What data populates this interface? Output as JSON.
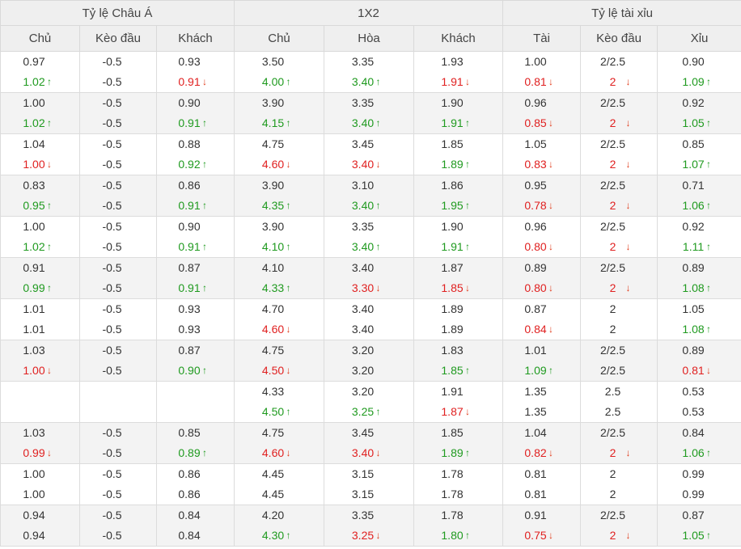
{
  "header": {
    "groups": [
      "Tỷ lệ Châu Á",
      "1X2",
      "Tỷ lệ tài xỉu"
    ],
    "columns": [
      "Chủ",
      "Kèo đầu",
      "Khách",
      "Chủ",
      "Hòa",
      "Khách",
      "Tài",
      "Kèo đầu",
      "Xỉu"
    ]
  },
  "icons": {
    "up": "arrow-up-icon",
    "down": "arrow-down-icon"
  },
  "colors": {
    "up": "#1f9a1f",
    "down": "#e02020",
    "header_bg": "#efefef",
    "alt_row_bg": "#f3f3f3"
  },
  "rows": [
    [
      [
        "0.97",
        "1.02",
        "u"
      ],
      [
        "-0.5",
        "-0.5",
        ""
      ],
      [
        "0.93",
        "0.91",
        "d"
      ],
      [
        "3.50",
        "4.00",
        "u"
      ],
      [
        "3.35",
        "3.40",
        "u"
      ],
      [
        "1.93",
        "1.91",
        "d"
      ],
      [
        "1.00",
        "0.81",
        "d"
      ],
      [
        "2/2.5",
        "2",
        "d"
      ],
      [
        "0.90",
        "1.09",
        "u"
      ]
    ],
    [
      [
        "1.00",
        "1.02",
        "u"
      ],
      [
        "-0.5",
        "-0.5",
        ""
      ],
      [
        "0.90",
        "0.91",
        "u"
      ],
      [
        "3.90",
        "4.15",
        "u"
      ],
      [
        "3.35",
        "3.40",
        "u"
      ],
      [
        "1.90",
        "1.91",
        "u"
      ],
      [
        "0.96",
        "0.85",
        "d"
      ],
      [
        "2/2.5",
        "2",
        "d"
      ],
      [
        "0.92",
        "1.05",
        "u"
      ]
    ],
    [
      [
        "1.04",
        "1.00",
        "d"
      ],
      [
        "-0.5",
        "-0.5",
        ""
      ],
      [
        "0.88",
        "0.92",
        "u"
      ],
      [
        "4.75",
        "4.60",
        "d"
      ],
      [
        "3.45",
        "3.40",
        "d"
      ],
      [
        "1.85",
        "1.89",
        "u"
      ],
      [
        "1.05",
        "0.83",
        "d"
      ],
      [
        "2/2.5",
        "2",
        "d"
      ],
      [
        "0.85",
        "1.07",
        "u"
      ]
    ],
    [
      [
        "0.83",
        "0.95",
        "u"
      ],
      [
        "-0.5",
        "-0.5",
        ""
      ],
      [
        "0.86",
        "0.91",
        "u"
      ],
      [
        "3.90",
        "4.35",
        "u"
      ],
      [
        "3.10",
        "3.40",
        "u"
      ],
      [
        "1.86",
        "1.95",
        "u"
      ],
      [
        "0.95",
        "0.78",
        "d"
      ],
      [
        "2/2.5",
        "2",
        "d"
      ],
      [
        "0.71",
        "1.06",
        "u"
      ]
    ],
    [
      [
        "1.00",
        "1.02",
        "u"
      ],
      [
        "-0.5",
        "-0.5",
        ""
      ],
      [
        "0.90",
        "0.91",
        "u"
      ],
      [
        "3.90",
        "4.10",
        "u"
      ],
      [
        "3.35",
        "3.40",
        "u"
      ],
      [
        "1.90",
        "1.91",
        "u"
      ],
      [
        "0.96",
        "0.80",
        "d"
      ],
      [
        "2/2.5",
        "2",
        "d"
      ],
      [
        "0.92",
        "1.11",
        "u"
      ]
    ],
    [
      [
        "0.91",
        "0.99",
        "u"
      ],
      [
        "-0.5",
        "-0.5",
        ""
      ],
      [
        "0.87",
        "0.91",
        "u"
      ],
      [
        "4.10",
        "4.33",
        "u"
      ],
      [
        "3.40",
        "3.30",
        "d"
      ],
      [
        "1.87",
        "1.85",
        "d"
      ],
      [
        "0.89",
        "0.80",
        "d"
      ],
      [
        "2/2.5",
        "2",
        "d"
      ],
      [
        "0.89",
        "1.08",
        "u"
      ]
    ],
    [
      [
        "1.01",
        "1.01",
        ""
      ],
      [
        "-0.5",
        "-0.5",
        ""
      ],
      [
        "0.93",
        "0.93",
        ""
      ],
      [
        "4.70",
        "4.60",
        "d"
      ],
      [
        "3.40",
        "3.40",
        ""
      ],
      [
        "1.89",
        "1.89",
        ""
      ],
      [
        "0.87",
        "0.84",
        "d"
      ],
      [
        "2",
        "2",
        ""
      ],
      [
        "1.05",
        "1.08",
        "u"
      ]
    ],
    [
      [
        "1.03",
        "1.00",
        "d"
      ],
      [
        "-0.5",
        "-0.5",
        ""
      ],
      [
        "0.87",
        "0.90",
        "u"
      ],
      [
        "4.75",
        "4.50",
        "d"
      ],
      [
        "3.20",
        "3.20",
        ""
      ],
      [
        "1.83",
        "1.85",
        "u"
      ],
      [
        "1.01",
        "1.09",
        "u"
      ],
      [
        "2/2.5",
        "2/2.5",
        ""
      ],
      [
        "0.89",
        "0.81",
        "d"
      ]
    ],
    [
      [
        "",
        "",
        ""
      ],
      [
        "",
        "",
        ""
      ],
      [
        "",
        "",
        ""
      ],
      [
        "4.33",
        "4.50",
        "u"
      ],
      [
        "3.20",
        "3.25",
        "u"
      ],
      [
        "1.91",
        "1.87",
        "d"
      ],
      [
        "1.35",
        "1.35",
        ""
      ],
      [
        "2.5",
        "2.5",
        ""
      ],
      [
        "0.53",
        "0.53",
        ""
      ]
    ],
    [
      [
        "1.03",
        "0.99",
        "d"
      ],
      [
        "-0.5",
        "-0.5",
        ""
      ],
      [
        "0.85",
        "0.89",
        "u"
      ],
      [
        "4.75",
        "4.60",
        "d"
      ],
      [
        "3.45",
        "3.40",
        "d"
      ],
      [
        "1.85",
        "1.89",
        "u"
      ],
      [
        "1.04",
        "0.82",
        "d"
      ],
      [
        "2/2.5",
        "2",
        "d"
      ],
      [
        "0.84",
        "1.06",
        "u"
      ]
    ],
    [
      [
        "1.00",
        "1.00",
        ""
      ],
      [
        "-0.5",
        "-0.5",
        ""
      ],
      [
        "0.86",
        "0.86",
        ""
      ],
      [
        "4.45",
        "4.45",
        ""
      ],
      [
        "3.15",
        "3.15",
        ""
      ],
      [
        "1.78",
        "1.78",
        ""
      ],
      [
        "0.81",
        "0.81",
        ""
      ],
      [
        "2",
        "2",
        ""
      ],
      [
        "0.99",
        "0.99",
        ""
      ]
    ],
    [
      [
        "0.94",
        "0.94",
        ""
      ],
      [
        "-0.5",
        "-0.5",
        ""
      ],
      [
        "0.84",
        "0.84",
        ""
      ],
      [
        "4.20",
        "4.30",
        "u"
      ],
      [
        "3.35",
        "3.25",
        "d"
      ],
      [
        "1.78",
        "1.80",
        "u"
      ],
      [
        "0.91",
        "0.75",
        "d"
      ],
      [
        "2/2.5",
        "2",
        "d"
      ],
      [
        "0.87",
        "1.05",
        "u"
      ]
    ]
  ]
}
